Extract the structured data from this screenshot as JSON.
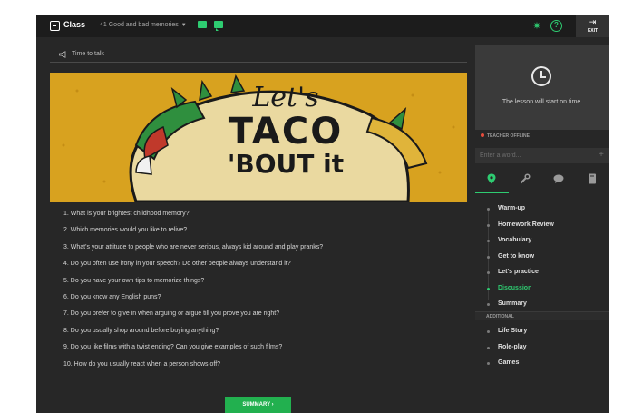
{
  "topbar": {
    "brand": "Class",
    "lesson_title": "41 Good and bad memories",
    "exit_label": "EXIT"
  },
  "section": {
    "title": "Time to talk"
  },
  "banner": {
    "line1": "Let's",
    "line2": "TACO",
    "line3": "'BOUT it"
  },
  "questions": [
    "1. What is your brightest childhood memory?",
    "2. Which memories would you like to relive?",
    "3. What's your attitude to people who are never serious, always kid around and play pranks?",
    "4. Do you often use irony in your speech? Do other people always understand it?",
    "5. Do you have your own tips to memorize things?",
    "6. Do you know any English puns?",
    "7. Do you prefer to give in when arguing or argue till you prove you are right?",
    "8. Do you usually shop around before buying anything?",
    "9. Do you like films with a twist ending? Can you give examples of such films?",
    "10. How do you usually react when a person shows off?"
  ],
  "summary_button": "SUMMARY ›",
  "sidebar": {
    "preview_text": "The lesson will start on time.",
    "teacher_status": "TEACHER OFFLINE",
    "word_placeholder": "Enter a word...",
    "steps": [
      {
        "label": "Warm-up",
        "current": false
      },
      {
        "label": "Homework Review",
        "current": false
      },
      {
        "label": "Vocabulary",
        "current": false
      },
      {
        "label": "Get to know",
        "current": false
      },
      {
        "label": "Let's practice",
        "current": false
      },
      {
        "label": "Discussion",
        "current": true
      },
      {
        "label": "Summary",
        "current": false
      }
    ],
    "additional_label": "ADDITIONAL",
    "extras": [
      "Life Story",
      "Role-play",
      "Games"
    ]
  },
  "colors": {
    "accent": "#2ecc71",
    "banner": "#d8a21f",
    "status_dot": "#e74c3c"
  }
}
